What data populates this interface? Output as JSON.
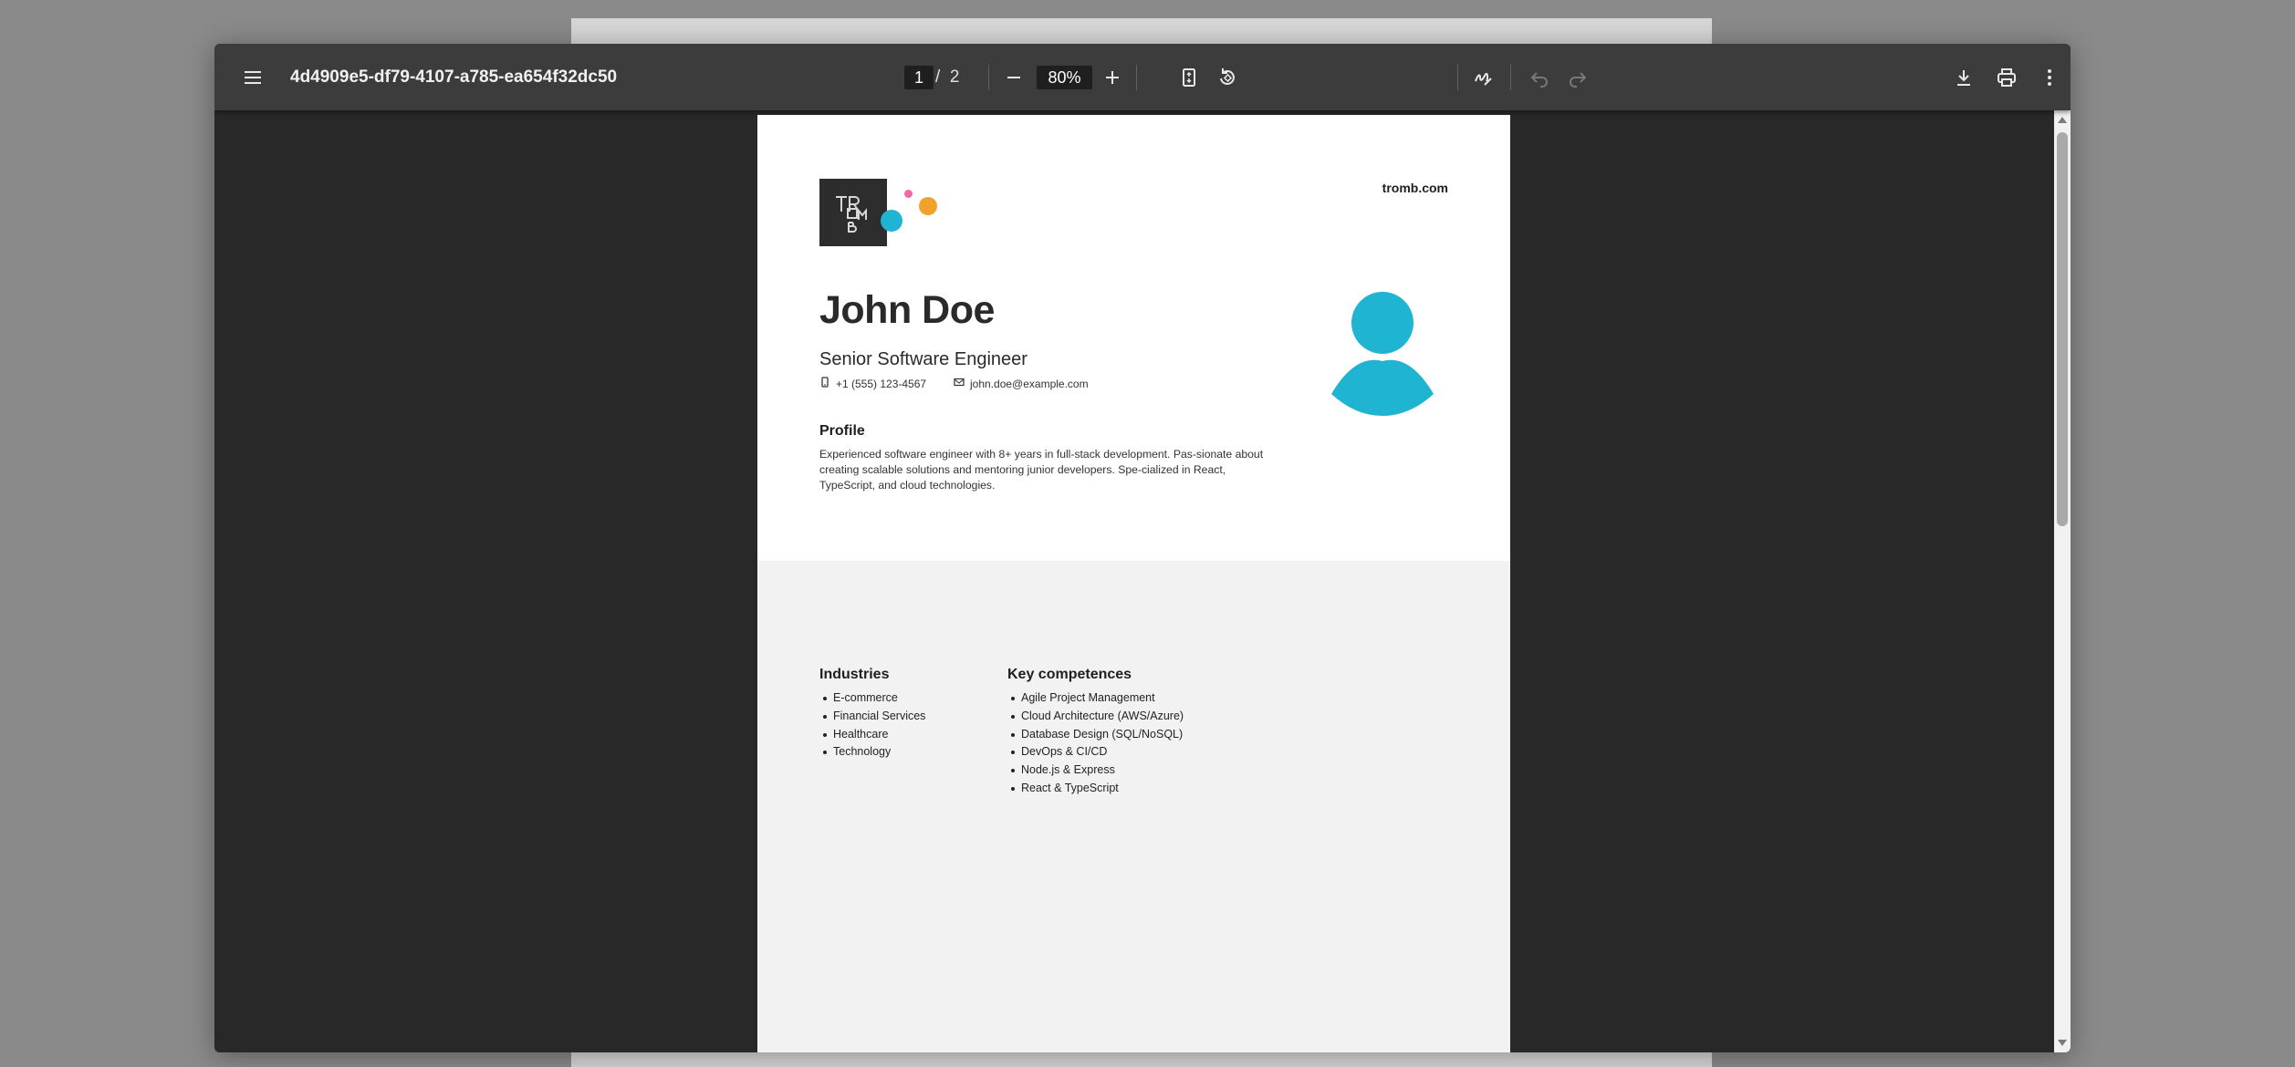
{
  "viewer": {
    "document_title": "4d4909e5-df79-4107-a785-ea654f32dc50",
    "current_page": "1",
    "page_separator": "/",
    "total_pages": "2",
    "zoom": "80%",
    "icons": [
      "menu-icon",
      "zoom-out-icon",
      "zoom-in-icon",
      "fit-page-icon",
      "rotate-icon",
      "draw-icon",
      "undo-icon",
      "redo-icon",
      "download-icon",
      "print-icon",
      "more-icon"
    ]
  },
  "document": {
    "site": "tromb.com",
    "logo_text": "TROMB",
    "name": "John Doe",
    "job_title": "Senior Software Engineer",
    "phone": "+1 (555) 123-4567",
    "email": "john.doe@example.com",
    "profile_heading": "Profile",
    "profile_text": "Experienced software engineer with 8+ years in full-stack development. Pas-sionate about creating scalable solutions and mentoring junior developers. Spe-cialized in React, TypeScript, and cloud technologies.",
    "industries_heading": "Industries",
    "industries": [
      "E-commerce",
      "Financial Services",
      "Healthcare",
      "Technology"
    ],
    "competences_heading": "Key competences",
    "competences": [
      "Agile Project Management",
      "Cloud Architecture (AWS/Azure)",
      "Database Design (SQL/NoSQL)",
      "DevOps & CI/CD",
      "Node.js & Express",
      "React & TypeScript"
    ]
  },
  "colors": {
    "accent_cyan": "#1fb4d2",
    "accent_orange": "#f0a22a",
    "accent_pink": "#f06aa0",
    "toolbar_bg": "#3c3c3c",
    "viewer_bg": "#282828"
  }
}
